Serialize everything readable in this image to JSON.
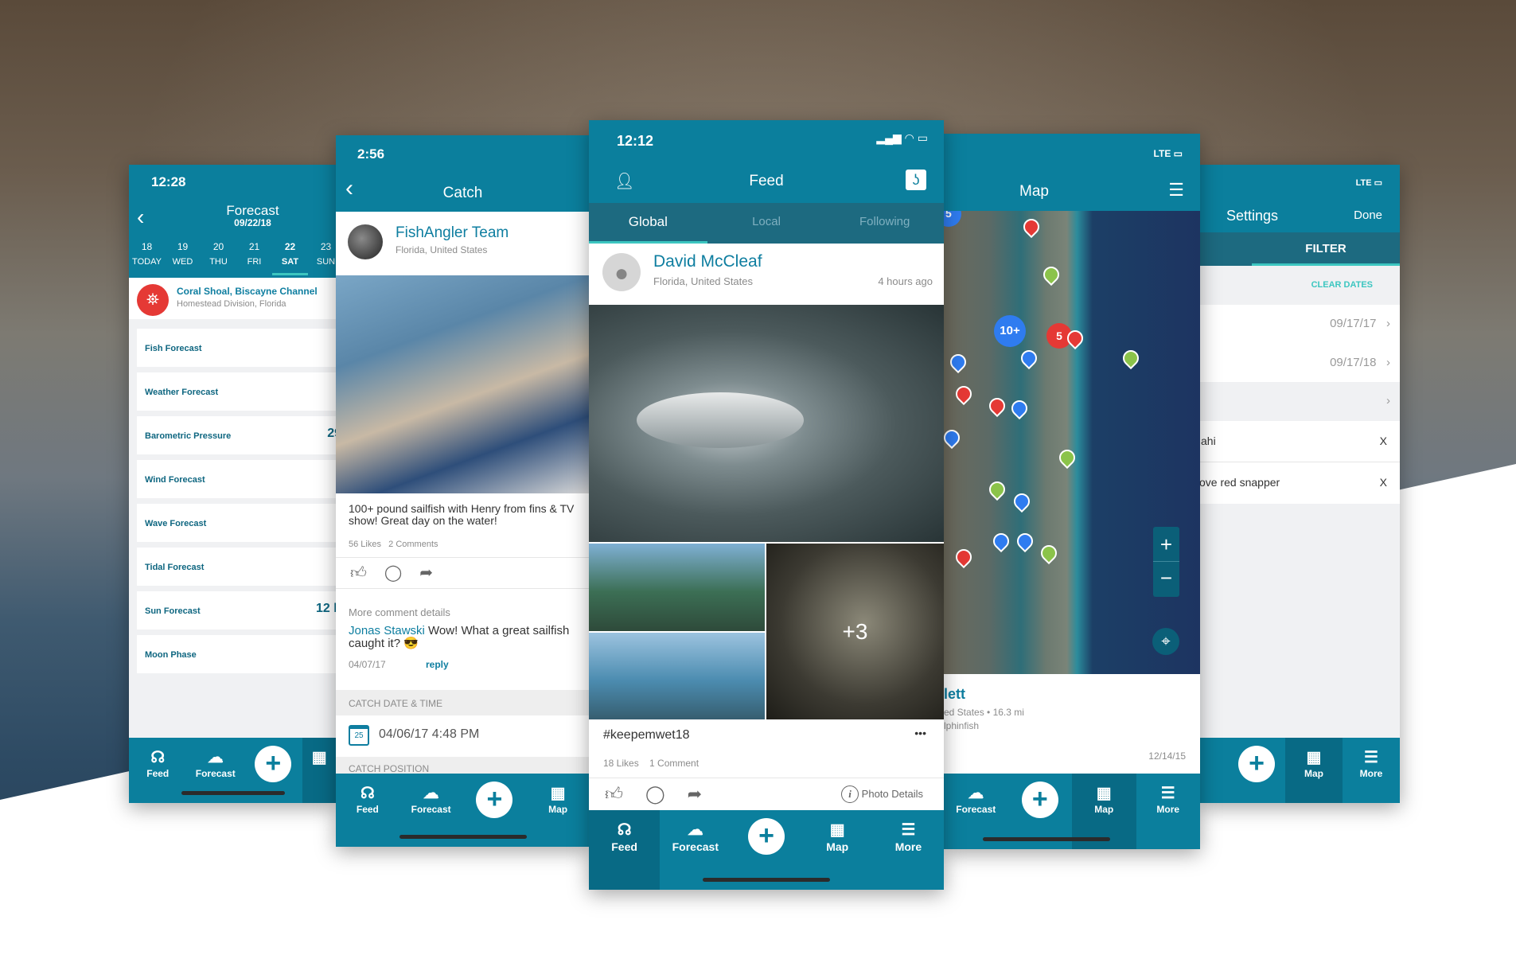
{
  "colors": {
    "brand": "#0b7f9d",
    "brand_dark": "#086a85",
    "accent": "#3cc6c0",
    "title_blue": "#0e7ea0",
    "alert_red": "#e53935"
  },
  "nav": {
    "feed": "Feed",
    "forecast": "Forecast",
    "map": "Map",
    "more": "More",
    "add": "+",
    "icons": {
      "feed": "fish-signal-icon",
      "forecast": "weather-icon",
      "map": "map-pin-icon",
      "more": "hamburger-icon",
      "add": "plus-icon"
    }
  },
  "forecast": {
    "time": "12:28",
    "title": "Forecast",
    "date": "09/22/18",
    "days": [
      {
        "num": "18",
        "day": "TODAY"
      },
      {
        "num": "19",
        "day": "WED"
      },
      {
        "num": "20",
        "day": "THU"
      },
      {
        "num": "21",
        "day": "FRI"
      },
      {
        "num": "22",
        "day": "SAT"
      },
      {
        "num": "23",
        "day": "SUN"
      }
    ],
    "selected_day": "22",
    "location": {
      "name": "Coral Shoal, Biscayne Channel",
      "sub": "Homestead Division, Florida",
      "icon": "buoy-icon"
    },
    "items": [
      {
        "label": "Fish Forecast",
        "value": ""
      },
      {
        "label": "Weather Forecast",
        "value": ""
      },
      {
        "label": "Barometric Pressure",
        "value": "29"
      },
      {
        "label": "Wind Forecast",
        "value": ""
      },
      {
        "label": "Wave Forecast",
        "value": ""
      },
      {
        "label": "Tidal Forecast",
        "value": ""
      },
      {
        "label": "Sun Forecast",
        "value": "12 h"
      },
      {
        "label": "Moon Phase",
        "value": ""
      }
    ]
  },
  "catch": {
    "time": "2:56",
    "title": "Catch",
    "user": "FishAngler Team",
    "location": "Florida, United States",
    "caption": "100+ pound sailfish with Henry from fins & TV show! Great day on the water!",
    "likes": "56 Likes",
    "comments": "2 Comments",
    "more_comments": "More comment details",
    "comment": {
      "author": "Jonas Stawski",
      "text": "Wow! What a great sailfish caught it? 😎",
      "date": "04/07/17",
      "reply": "reply"
    },
    "section_date": "CATCH DATE & TIME",
    "catch_date": "04/06/17 4:48 PM",
    "calendar_day": "25",
    "section_position": "CATCH POSITION"
  },
  "feed": {
    "time": "12:12",
    "title": "Feed",
    "tabs": [
      "Global",
      "Local",
      "Following"
    ],
    "active_tab": "Global",
    "user": "David McCleaf",
    "location": "Florida, United States",
    "ago": "4 hours ago",
    "more_photos": "+3",
    "hashtag": "#keepemwet18",
    "more": "•••",
    "likes": "18 Likes",
    "comments": "1 Comment",
    "photo_details": "Photo Details"
  },
  "map": {
    "title": "Map",
    "network": "LTE",
    "cluster_labels": [
      "5",
      "10+",
      "5"
    ],
    "zoom_in": "+",
    "zoom_out": "−",
    "card": {
      "name": "lett",
      "sub": "ed States • 16.3 mi",
      "species": "lphinfish",
      "date": "12/14/15"
    }
  },
  "settings": {
    "title": "Settings",
    "done": "Done",
    "network": "LTE",
    "tab": "FILTER",
    "clear_dates": "CLEAR DATES",
    "dates": [
      "09/17/17",
      "09/17/18"
    ],
    "chevron": "›",
    "filters": [
      {
        "label": "ahi",
        "remove": "X"
      },
      {
        "label": "ove red snapper",
        "remove": "X"
      }
    ]
  }
}
